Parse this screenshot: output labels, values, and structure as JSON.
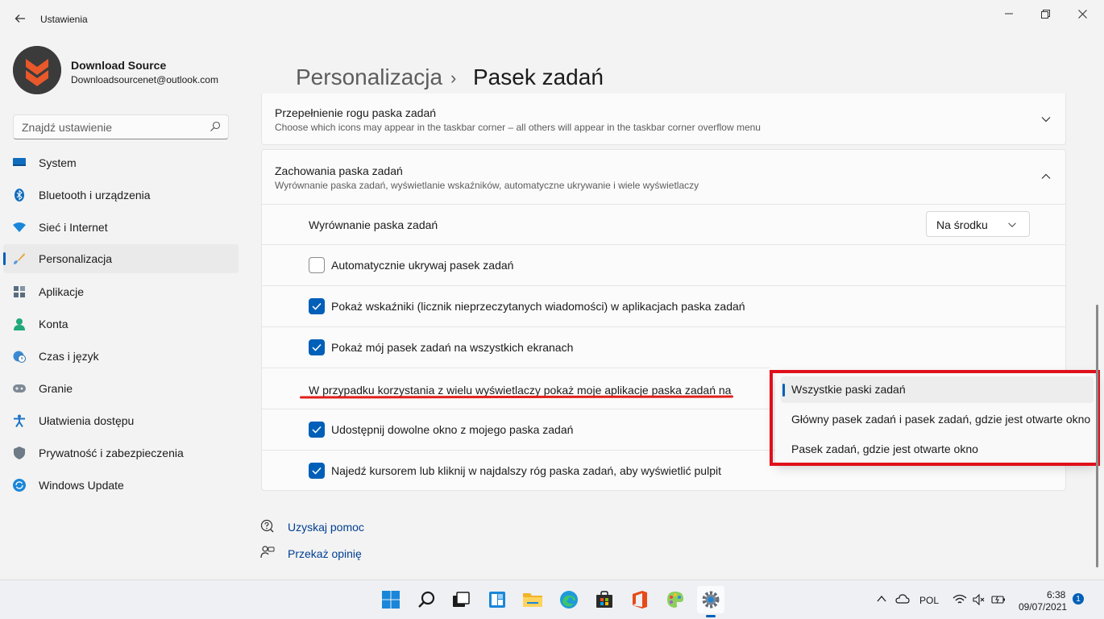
{
  "window": {
    "title": "Ustawienia",
    "controls": {
      "minimize": "—",
      "maximize": "☐",
      "close": "✕"
    }
  },
  "profile": {
    "name": "Download Source",
    "email": "Downloadsourcenet@outlook.com"
  },
  "search": {
    "placeholder": "Znajdź ustawienie"
  },
  "sidebar": {
    "items": [
      {
        "label": "System",
        "icon": "monitor-icon"
      },
      {
        "label": "Bluetooth i urządzenia",
        "icon": "bluetooth-icon"
      },
      {
        "label": "Sieć i Internet",
        "icon": "wifi-icon"
      },
      {
        "label": "Personalizacja",
        "icon": "brush-icon",
        "active": true
      },
      {
        "label": "Aplikacje",
        "icon": "apps-icon"
      },
      {
        "label": "Konta",
        "icon": "person-icon"
      },
      {
        "label": "Czas i język",
        "icon": "globe-clock-icon"
      },
      {
        "label": "Granie",
        "icon": "gamepad-icon"
      },
      {
        "label": "Ułatwienia dostępu",
        "icon": "accessibility-icon"
      },
      {
        "label": "Prywatność i zabezpieczenia",
        "icon": "shield-icon"
      },
      {
        "label": "Windows Update",
        "icon": "update-icon"
      }
    ]
  },
  "breadcrumb": {
    "parent": "Personalizacja",
    "separator": "›",
    "current": "Pasek zadań"
  },
  "cards": {
    "overflow": {
      "title": "Przepełnienie rogu paska zadań",
      "subtitle": "Choose which icons may appear in the taskbar corner – all others will appear in the taskbar corner overflow menu"
    },
    "behaviors": {
      "title": "Zachowania paska zadań",
      "subtitle": "Wyrównanie paska zadań, wyświetlanie wskaźników, automatyczne ukrywanie i wiele wyświetlaczy"
    }
  },
  "settings": {
    "alignment_label": "Wyrównanie paska zadań",
    "alignment_value": "Na środku",
    "auto_hide": {
      "label": "Automatycznie ukrywaj pasek zadań",
      "checked": false
    },
    "badges": {
      "label": "Pokaż wskaźniki (licznik nieprzeczytanych wiadomości) w aplikacjach paska zadań",
      "checked": true
    },
    "all_displays": {
      "label": "Pokaż mój pasek zadań na wszystkich ekranach",
      "checked": true
    },
    "multi_display_label": "W przypadku korzystania z wielu wyświetlaczy pokaż moje aplikacje paska zadań na",
    "share_window": {
      "label": "Udostępnij dowolne okno z mojego paska zadań",
      "checked": true
    },
    "show_desktop": {
      "label": "Najedź kursorem lub kliknij w najdalszy róg paska zadań, aby wyświetlić pulpit",
      "checked": true
    }
  },
  "multi_display_options": [
    {
      "label": "Wszystkie paski zadań",
      "selected": true
    },
    {
      "label": "Główny pasek zadań i pasek zadań, gdzie jest otwarte okno",
      "selected": false
    },
    {
      "label": "Pasek zadań, gdzie jest otwarte okno",
      "selected": false
    }
  ],
  "help": {
    "get_help": "Uzyskaj pomoc",
    "feedback": "Przekaż opinię"
  },
  "taskbar": {
    "apps": [
      "start-icon",
      "search-icon",
      "task-view-icon",
      "widgets-icon",
      "file-explorer-icon",
      "edge-icon",
      "store-icon",
      "office-icon",
      "paint-icon",
      "settings-icon"
    ],
    "language": "POL",
    "time": "6:38",
    "date": "09/07/2021",
    "notifications": "1"
  },
  "colors": {
    "accent": "#005fb8",
    "annotation_red": "#e0101b"
  }
}
